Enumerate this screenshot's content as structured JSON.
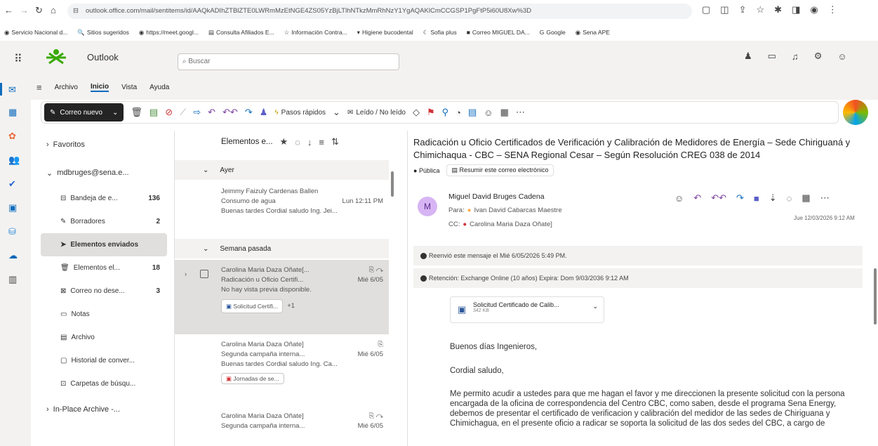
{
  "browser": {
    "url": "outlook.office.com/mail/sentitems/id/AAQkADIhZTBlZTE0LWRmMzEtNGE4ZS05YzBjLTlhNTkzMmRhNzY1YgAQAKlCmCCGSP1PgFtP5i60U8Xw%3D",
    "bookmarks": [
      "Servicio Nacional d...",
      "Sitios sugeridos",
      "https://meet.googl...",
      "Consulta Afiliados E...",
      "Información Contra...",
      "Higiene bucodental",
      "Sofia plus",
      "Correo MIGUEL DA...",
      "Google",
      "Sena APE"
    ]
  },
  "app": {
    "name": "Outlook",
    "search_placeholder": "Buscar"
  },
  "menu": {
    "items": [
      "Archivo",
      "Inicio",
      "Vista",
      "Ayuda"
    ]
  },
  "ribbon": {
    "new_mail": "Correo nuevo",
    "quick_steps": "Pasos rápidos",
    "read_unread": "Leído / No leído"
  },
  "folders": {
    "favorites": "Favoritos",
    "account": "mdbruges@sena.e...",
    "items": [
      {
        "label": "Bandeja de e...",
        "count": "136"
      },
      {
        "label": "Borradores",
        "count": "2"
      },
      {
        "label": "Elementos enviados",
        "count": ""
      },
      {
        "label": "Elementos el...",
        "count": "18"
      },
      {
        "label": "Correo no dese...",
        "count": "3"
      },
      {
        "label": "Notas",
        "count": ""
      },
      {
        "label": "Archivo",
        "count": ""
      },
      {
        "label": "Historial de conver...",
        "count": ""
      },
      {
        "label": "Carpetas de búsqu...",
        "count": ""
      }
    ],
    "archive": "In-Place Archive -..."
  },
  "list": {
    "title": "Elementos e...",
    "group_yesterday": "Ayer",
    "group_last_week": "Semana pasada",
    "m1": {
      "from": "Jeimmy Faizuly Cardenas Ballen",
      "subject": "Consumo de agua",
      "date": "Lun 12:11 PM",
      "preview": "Buenas tardes Cordial saludo Ing. Jei..."
    },
    "m2": {
      "from": "Carolina Maria Daza Oñate[...",
      "subject": "Radicación u Oficio Certifi...",
      "date": "Mié 6/05",
      "preview": "No hay vista previa disponible.",
      "attach": "Solicitud Certifi...",
      "extra": "+1"
    },
    "m3": {
      "from": "Carolina Maria Daza Oñate]",
      "subject": "Segunda campaña interna...",
      "date": "Mié 6/05",
      "preview": "Buenas tardes Cordial saludo Ing. Ca...",
      "attach": "Jornadas de se..."
    },
    "m4": {
      "from": "Carolina Maria Daza Oñate]",
      "subject": "Segunda campaña interna...",
      "date": "Mié 6/05"
    }
  },
  "reading": {
    "subject": "Radicación u Oficio Certificados de Verificación y Calibración de Medidores de Energía – Sede Chiriguaná y Chimichaqua - CBC – SENA Regional Cesar – Según Resolución CREG 038 de 2014",
    "tag": "Pública",
    "summarize": "Resumir este correo electrónico",
    "sender": "Miguel David Bruges Cadena",
    "avatar": "M",
    "to_label": "Para:",
    "to": "Ivan David Cabarcas Maestre",
    "cc_label": "CC:",
    "cc": "Carolina Maria Daza Oñate]",
    "datetime": "Jue 12/03/2026 9:12 AM",
    "forwarded": "Reenvió este mensaje el Mié 6/05/2026 5:49 PM.",
    "retention": "Retención: Exchange Online (10 años) Expira: Dom 9/03/2036 9:12 AM",
    "attachment_name": "Solicitud Certificado de Calib...",
    "attachment_size": "342 KB",
    "greeting": "Buenos días Ingenieros,",
    "salutation": "Cordial saludo,",
    "para": "Me permito acudir a ustedes para que me hagan el favor y me  direccionen la presente solicitud con la persona encargada de la oficina de correspondencia del Centro CBC, como saben, desde el programa Sena Energy, debemos de presentar el certificado de verificacion  y calibración del medidor de las sedes de Chiriguana y Chimichagua, en el presente oficio a radicar se soporta la solicitud de las dos sedes del CBC,  a cargo de"
  }
}
